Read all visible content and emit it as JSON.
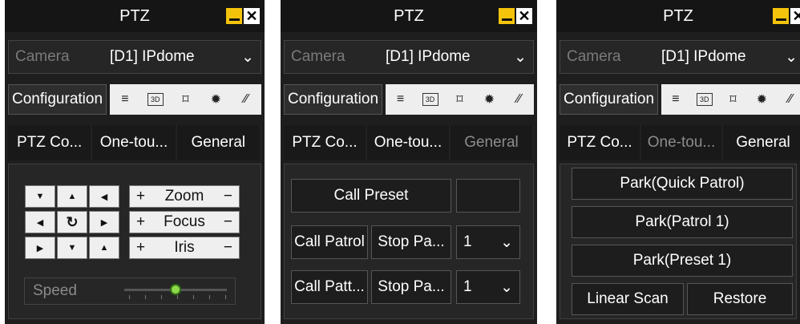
{
  "panels": [
    {
      "title": "PTZ",
      "camera_label": "Camera",
      "camera_value": "[D1] IPdome",
      "config_label": "Configuration",
      "tabs": [
        "PTZ Co...",
        "One-tou...",
        "General"
      ],
      "active_tab": "PTZ Co...",
      "zoom_label": "Zoom",
      "focus_label": "Focus",
      "iris_label": "Iris",
      "plus": "+",
      "minus": "−",
      "speed_label": "Speed"
    },
    {
      "title": "PTZ",
      "camera_label": "Camera",
      "camera_value": "[D1] IPdome",
      "config_label": "Configuration",
      "tabs": [
        "PTZ Co...",
        "One-tou...",
        "General"
      ],
      "active_tab": "One-tou...",
      "call_preset": "Call Preset",
      "call_patrol": "Call Patrol",
      "stop_patrol": "Stop Pa...",
      "patrol_value": "1",
      "call_pattern": "Call Patt...",
      "stop_pattern": "Stop Pa...",
      "pattern_value": "1"
    },
    {
      "title": "PTZ",
      "camera_label": "Camera",
      "camera_value": "[D1] IPdome",
      "config_label": "Configuration",
      "tabs": [
        "PTZ Co...",
        "One-tou...",
        "General"
      ],
      "active_tab": "General",
      "park_quick": "Park(Quick Patrol)",
      "park_patrol": "Park(Patrol 1)",
      "park_preset": "Park(Preset 1)",
      "linear_scan": "Linear Scan",
      "restore": "Restore"
    }
  ],
  "icons": {
    "menu": "≡",
    "threed": "3D",
    "frame": "⌑",
    "light": "✹",
    "wiper": "⁄⁄",
    "chevron": "⌄",
    "refresh": "↻"
  },
  "colors": {
    "accent": "#f4c30c",
    "speed_knob": "#8ed94b"
  },
  "speed_level": 0.5
}
